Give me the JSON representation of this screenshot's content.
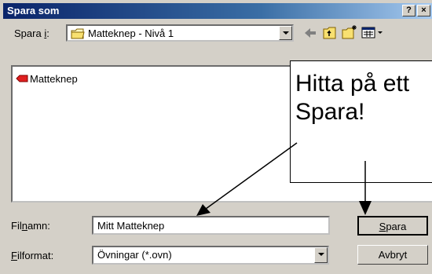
{
  "dialog": {
    "title": "Spara som",
    "help_btn": "?",
    "close_btn": "×"
  },
  "toolbar": {
    "save_in_label_pre": "Spara ",
    "save_in_label_key": "i",
    "save_in_label_post": ":",
    "folder_value": "Matteknep - Nivå 1"
  },
  "filelist": {
    "items": [
      {
        "name": "Matteknep",
        "icon": "red-file-icon"
      }
    ]
  },
  "callout": {
    "line1": "Hitta på ett",
    "line2": "Spara!"
  },
  "filename": {
    "label_pre": "Fil",
    "label_key": "n",
    "label_post": "amn:",
    "value": "Mitt Matteknep"
  },
  "filetype": {
    "label_key": "F",
    "label_post": "ilformat:",
    "value": "Övningar (*.ovn)"
  },
  "buttons": {
    "save_key": "S",
    "save_rest": "para",
    "cancel": "Avbryt"
  },
  "colors": {
    "titlebar_start": "#0a246a",
    "titlebar_end": "#a6caf0",
    "face": "#d4d0c8"
  }
}
